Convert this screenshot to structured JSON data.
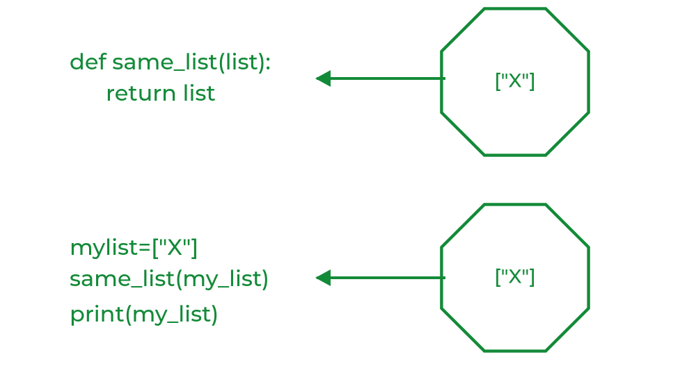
{
  "blocks": {
    "top": {
      "line1": "def same_list(list):",
      "line2": "return list"
    },
    "bottom": {
      "line1": "mylist=[\"X\"]",
      "line2": "same_list(my_list)",
      "line3": "print(my_list)"
    }
  },
  "octagons": {
    "top_label": "[\"X\"]",
    "bottom_label": "[\"X\"]"
  },
  "colors": {
    "stroke": "#138a38"
  }
}
